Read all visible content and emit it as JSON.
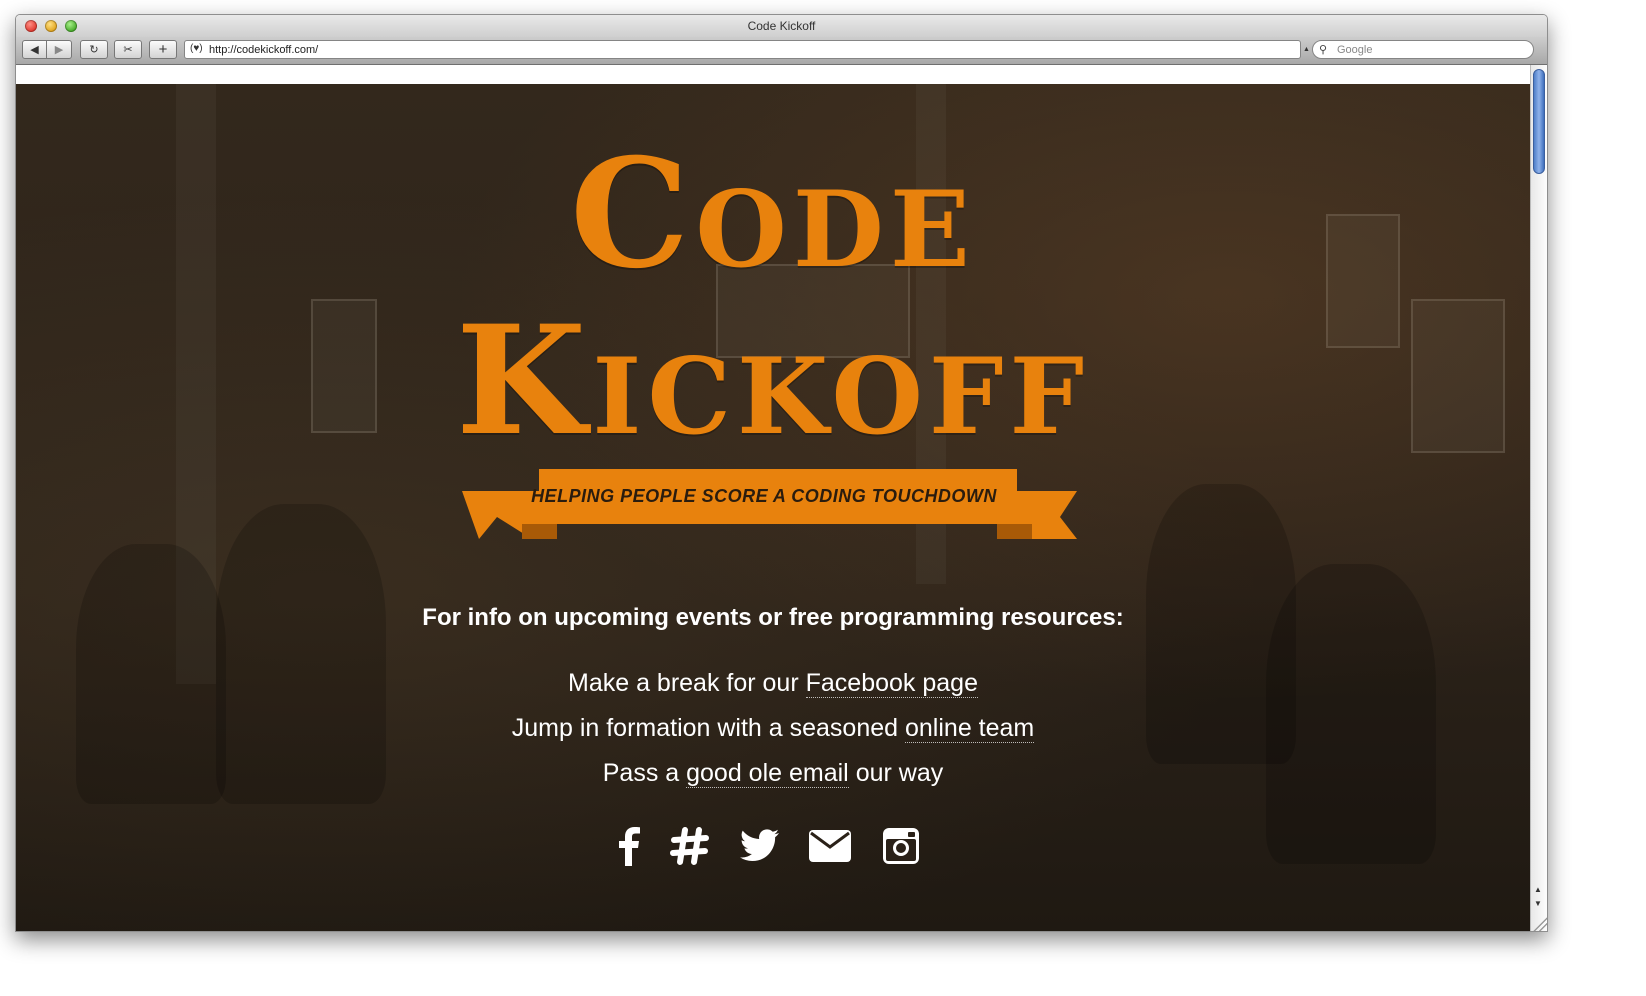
{
  "window": {
    "title": "Code Kickoff"
  },
  "toolbar": {
    "back_icon": "back-arrow-icon",
    "forward_icon": "forward-arrow-icon",
    "reload_icon": "reload-icon",
    "snapshot_icon": "webclip-icon",
    "add_icon": "plus-icon",
    "url": "http://codekickoff.com/",
    "search_placeholder": "Google"
  },
  "hero": {
    "title_line1": "Code",
    "title_line2": "Kickoff",
    "tagline": "HELPING PEOPLE SCORE A CODING TOUCHDOWN",
    "accent_color": "#e8820d"
  },
  "content": {
    "intro": "For info on upcoming events or free programming resources:",
    "line1_pre": "Make a break for our ",
    "line1_link": "Facebook page",
    "line1_post": "",
    "line2_pre": "Jump in formation with a seasoned ",
    "line2_link": "online team",
    "line2_post": "",
    "line3_pre": "Pass a ",
    "line3_link": "good ole email",
    "line3_post": " our way"
  },
  "socials": [
    "facebook-icon",
    "hashtag-icon",
    "twitter-icon",
    "email-icon",
    "instagram-icon"
  ]
}
